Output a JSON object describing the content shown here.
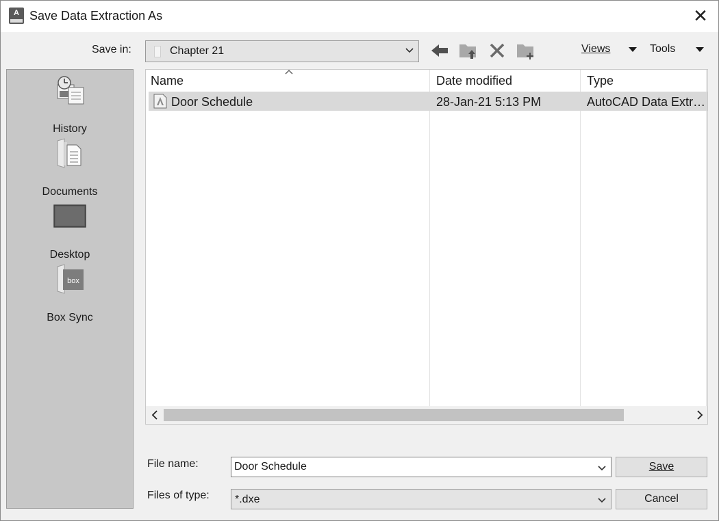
{
  "window": {
    "title": "Save Data Extraction As",
    "app_icon": "autocad-icon",
    "app_icon_letter": "A",
    "close_glyph": "✕"
  },
  "toolbar": {
    "save_in_label": "Save in:",
    "save_in_value": "Chapter 21",
    "views_label": "Views",
    "tools_label": "Tools",
    "icons": [
      "back-arrow-icon",
      "up-folder-icon",
      "delete-icon",
      "new-folder-icon"
    ]
  },
  "places": [
    {
      "label": "History",
      "icon": "history-icon"
    },
    {
      "label": "Documents",
      "icon": "documents-icon"
    },
    {
      "label": "Desktop",
      "icon": "desktop-icon"
    },
    {
      "label": "Box Sync",
      "icon": "box-sync-icon",
      "icon_text": "box"
    }
  ],
  "file_list": {
    "columns": [
      "Name",
      "Date modified",
      "Type"
    ],
    "sort_column": "Name",
    "rows": [
      {
        "name": "Door Schedule",
        "date_modified": "28-Jan-21 5:13 PM",
        "type": "AutoCAD Data Extr…",
        "selected": true
      }
    ]
  },
  "bottom": {
    "file_name_label": "File name:",
    "file_name_value": "Door Schedule",
    "files_of_type_label": "Files of type:",
    "files_of_type_value": "*.dxe",
    "save_label": "Save",
    "cancel_label": "Cancel"
  },
  "colors": {
    "dialog_bg": "#f0f0f0",
    "sidebar_bg": "#c7c7c7",
    "selected_row": "#d9d9d9"
  }
}
